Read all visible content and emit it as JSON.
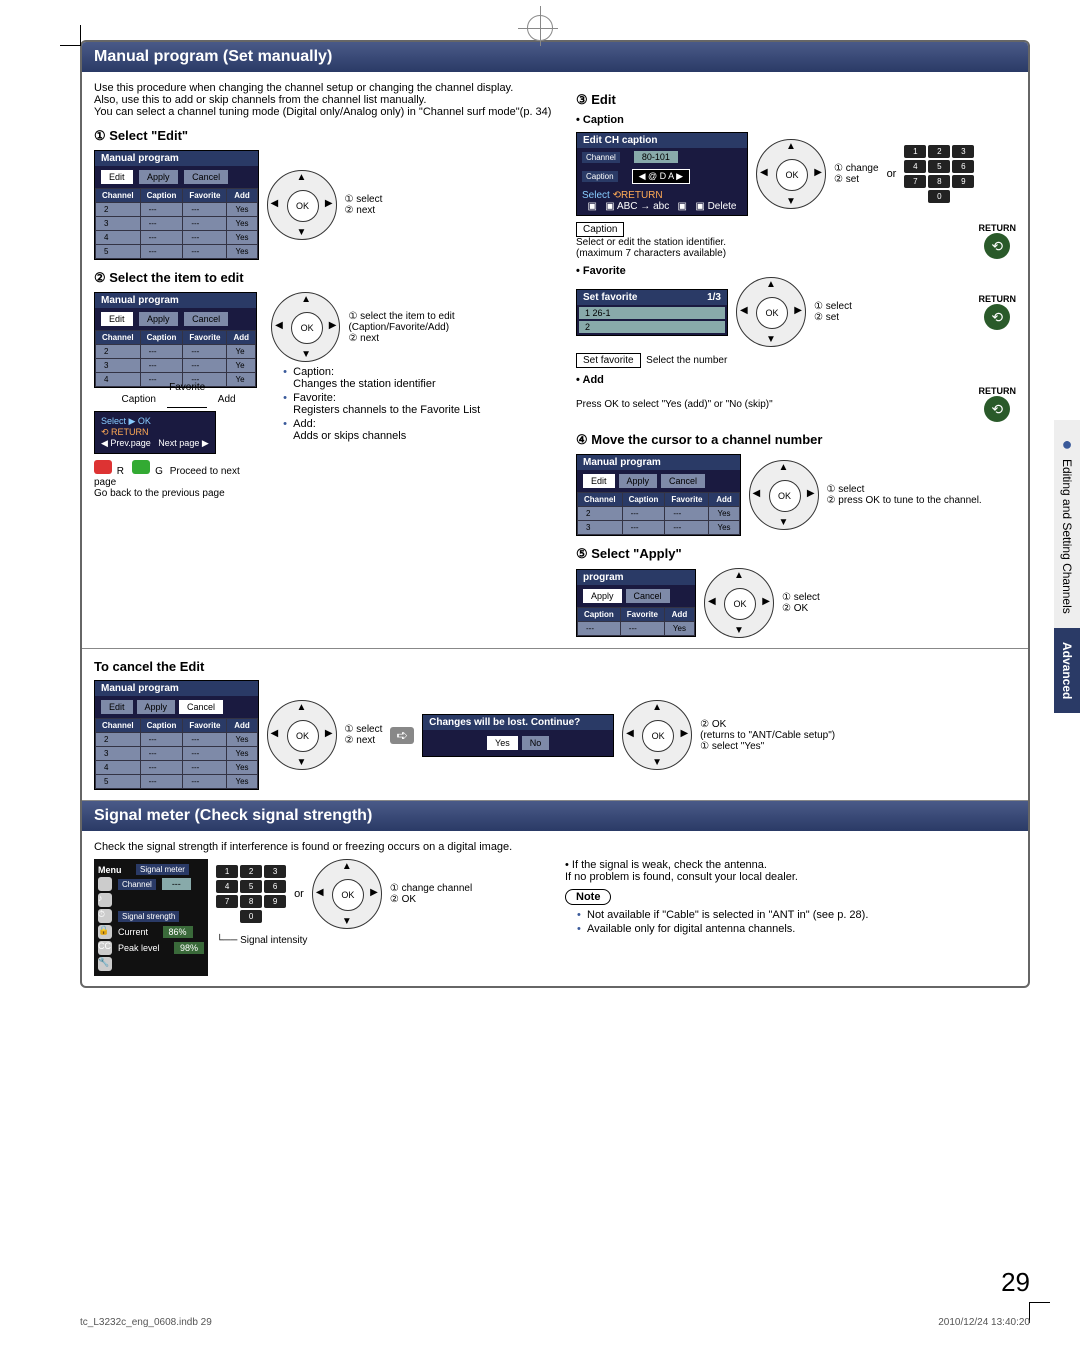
{
  "page_number": "29",
  "footer": {
    "file": "tc_L3232c_eng_0608.indb   29",
    "timestamp": "2010/12/24   13:40:20"
  },
  "side": {
    "tab1": "Editing and Setting Channels",
    "tab2": "Advanced"
  },
  "section1": {
    "banner": "Manual program (Set manually)",
    "intro": "Use this procedure when changing the channel setup or changing the channel display.\nAlso, use this to add or skip channels from the channel list manually.\nYou can select a channel tuning mode (Digital only/Analog only) in \"Channel surf mode\"(p. 34)",
    "step1_title": "① Select \"Edit\"",
    "step1_cb1": "① select",
    "step1_cb2": "② next",
    "step2_title": "② Select the item to edit",
    "step2_cb1": "① select the item to edit (Caption/Favorite/Add)",
    "step2_cb2": "② next",
    "labels": {
      "caption": "Caption",
      "favorite": "Favorite",
      "add": "Add"
    },
    "caption_desc": "Caption:\nChanges the station identifier",
    "favorite_desc": "Favorite:\nRegisters channels to the Favorite List",
    "add_desc": "Add:\nAdds or skips channels",
    "proceed": "Proceed to next page",
    "goback": "Go back to the previous page",
    "osd": {
      "title": "Manual program",
      "tabs": [
        "Edit",
        "Apply",
        "Cancel"
      ],
      "cols": [
        "Channel",
        "Caption",
        "Favorite",
        "Add"
      ],
      "rows": [
        [
          "2",
          "---",
          "---",
          "Yes"
        ],
        [
          "3",
          "---",
          "---",
          "Yes"
        ],
        [
          "4",
          "---",
          "---",
          "Yes"
        ],
        [
          "5",
          "---",
          "---",
          "Yes"
        ]
      ]
    },
    "prev": "Prev.page",
    "next": "Next page",
    "step3_title": "③ Edit",
    "sub_caption": "• Caption",
    "edit_ch": {
      "title": "Edit CH caption",
      "chlabel": "Channel",
      "chval": "80-101",
      "caplabel": "Caption",
      "capval": "◀ @ D A ▶",
      "select": "Select",
      "abc": "ABC → abc",
      "delete": "Delete"
    },
    "or": "or",
    "cb_change": "① change",
    "cb_set": "② set",
    "caption_box": "Caption",
    "caption_exp": "Select or edit the station identifier.\n(maximum 7 characters available)",
    "return": "RETURN",
    "sub_fav": "• Favorite",
    "setfav": {
      "title": "Set favorite",
      "page": "1/3",
      "row1": "1   26-1",
      "row2": "2"
    },
    "fav_cb1": "① select",
    "fav_cb2": "② set",
    "setfav_box": "Set favorite",
    "setfav_exp": "Select the number",
    "sub_add": "• Add",
    "add_exp": "Press OK to select \"Yes (add)\" or \"No (skip)\"",
    "step4_title": "④ Move the cursor to a channel number",
    "s4_cb1": "① select",
    "s4_cb2": "② press OK to tune to the channel.",
    "step5_title": "⑤ Select \"Apply\"",
    "s5_osd": "program",
    "s5_cb1": "① select",
    "s5_cb2": "② OK",
    "cancel_title": "To cancel the Edit",
    "cancel_cb1": "① select",
    "cancel_cb2": "② next",
    "confirm": {
      "title": "Changes will be lost. Continue?",
      "yes": "Yes",
      "no": "No"
    },
    "cancel_r1": "② OK",
    "cancel_r2": "(returns to \"ANT/Cable setup\")",
    "cancel_r3": "① select \"Yes\""
  },
  "section2": {
    "banner": "Signal meter (Check signal strength)",
    "intro": "Check the signal strength if interference is found or freezing occurs on a digital image.",
    "menu": {
      "menu": "Menu",
      "title": "Signal meter",
      "channel": "Channel",
      "chval": "---",
      "strength": "Signal strength",
      "current": "Current",
      "curval": "86%",
      "peak": "Peak level",
      "peakval": "98%"
    },
    "or": "or",
    "cb1": "① change channel",
    "cb2": "② OK",
    "siglabel": "Signal intensity",
    "weak": "• If the signal is weak, check the antenna.\n   If no problem is found, consult your local dealer.",
    "note": "Note",
    "n1": "Not available if \"Cable\" is selected in \"ANT in\" (see p. 28).",
    "n2": "Available only for digital antenna channels."
  }
}
